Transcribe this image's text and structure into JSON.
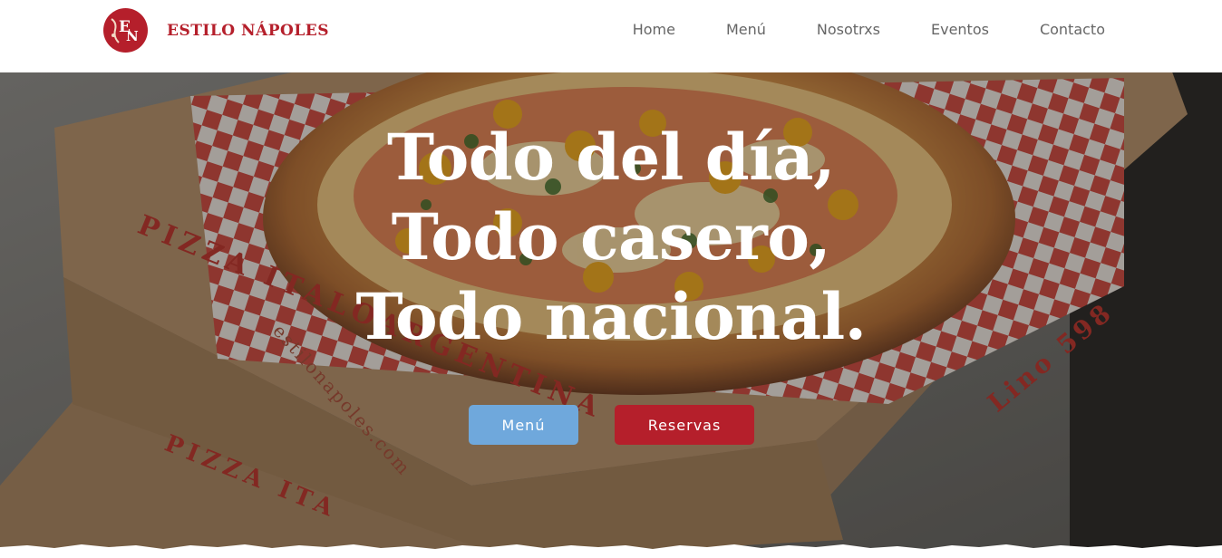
{
  "brand": {
    "name": "ESTILO NÁPOLES",
    "monogram": "EN",
    "color": "#b51f2b"
  },
  "nav": {
    "items": [
      {
        "label": "Home"
      },
      {
        "label": "Menú"
      },
      {
        "label": "Nosotrxs"
      },
      {
        "label": "Eventos"
      },
      {
        "label": "Contacto"
      }
    ]
  },
  "hero": {
    "headline_lines": [
      "Todo del día,",
      "Todo casero,",
      "Todo nacional."
    ],
    "image_subject": "pizza-in-boxes",
    "box_print": [
      "PIZZA ITALOARGENTINA",
      "PIZZA ITA",
      "estilonapoles.com",
      "Lino 598"
    ],
    "buttons": {
      "menu_label": "Menú",
      "reservas_label": "Reservas"
    },
    "colors": {
      "menu_button": "#6fa8dc",
      "reservas_button": "#b51f2b"
    }
  }
}
